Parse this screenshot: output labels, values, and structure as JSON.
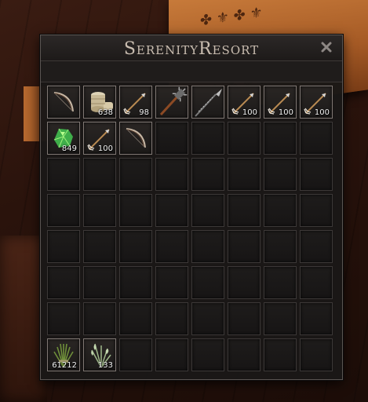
{
  "window": {
    "title": "SerenityResort"
  },
  "colors": {
    "window_bg": "#1a1817",
    "slot_border": "#3c3837",
    "slot_filled_border": "#807874",
    "title_text": "#c9bdb0",
    "wood": "#2a130c",
    "chest": "#c77a3a"
  },
  "inventory": {
    "columns": 8,
    "rows": 8,
    "items": [
      {
        "slot": 0,
        "icon": "bow-icon",
        "qty": ""
      },
      {
        "slot": 1,
        "icon": "cloth-bundle-icon",
        "qty": "638"
      },
      {
        "slot": 2,
        "icon": "arrow-icon",
        "qty": "98"
      },
      {
        "slot": 3,
        "icon": "mace-icon",
        "qty": ""
      },
      {
        "slot": 4,
        "icon": "spear-icon",
        "qty": ""
      },
      {
        "slot": 5,
        "icon": "arrow-icon",
        "qty": "100"
      },
      {
        "slot": 6,
        "icon": "arrow-icon",
        "qty": "100"
      },
      {
        "slot": 7,
        "icon": "arrow-icon",
        "qty": "100"
      },
      {
        "slot": 8,
        "icon": "green-crystal-icon",
        "qty": "849"
      },
      {
        "slot": 9,
        "icon": "arrow-icon",
        "qty": "100"
      },
      {
        "slot": 10,
        "icon": "bow-icon",
        "qty": ""
      },
      {
        "slot": 56,
        "icon": "plant-fiber-icon",
        "qty": "61212"
      },
      {
        "slot": 57,
        "icon": "herb-icon",
        "qty": "133"
      }
    ]
  }
}
